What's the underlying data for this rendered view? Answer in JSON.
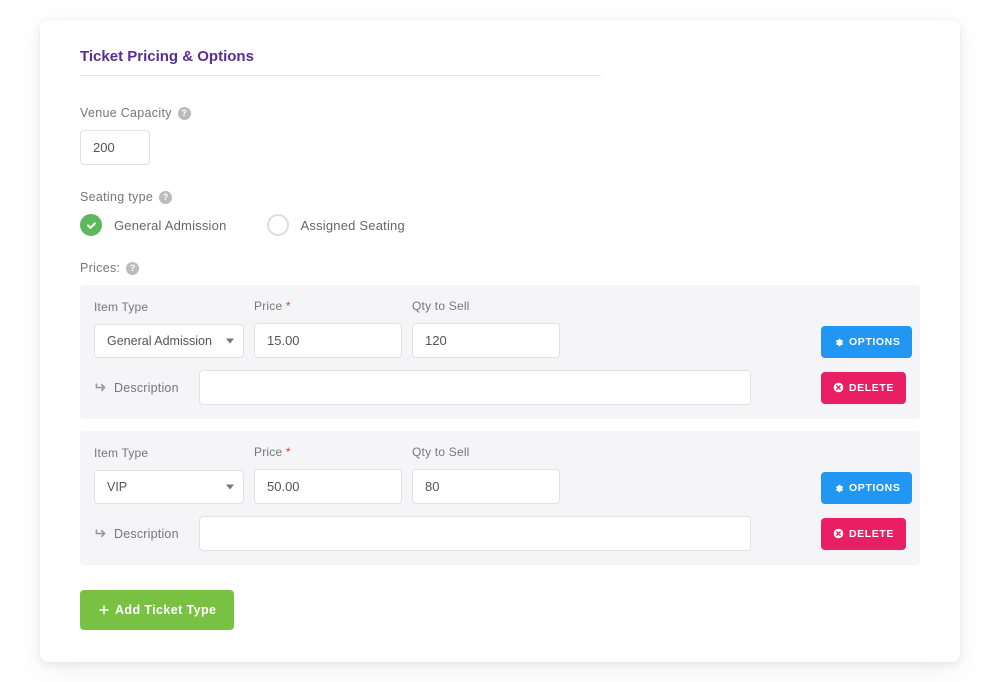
{
  "title": "Ticket Pricing & Options",
  "capacity": {
    "label": "Venue Capacity",
    "value": "200"
  },
  "seating": {
    "label": "Seating type",
    "options": {
      "general": "General Admission",
      "assigned": "Assigned Seating"
    },
    "selected": "general"
  },
  "prices": {
    "label": "Prices:",
    "headers": {
      "item_type": "Item Type",
      "price": "Price",
      "qty": "Qty to Sell"
    },
    "desc_label": "Description",
    "rows": [
      {
        "item_type": "General Admission",
        "price": "15.00",
        "qty": "120",
        "description": ""
      },
      {
        "item_type": "VIP",
        "price": "50.00",
        "qty": "80",
        "description": ""
      }
    ]
  },
  "buttons": {
    "options": "OPTIONS",
    "delete": "DELETE",
    "add": "Add Ticket Type"
  }
}
